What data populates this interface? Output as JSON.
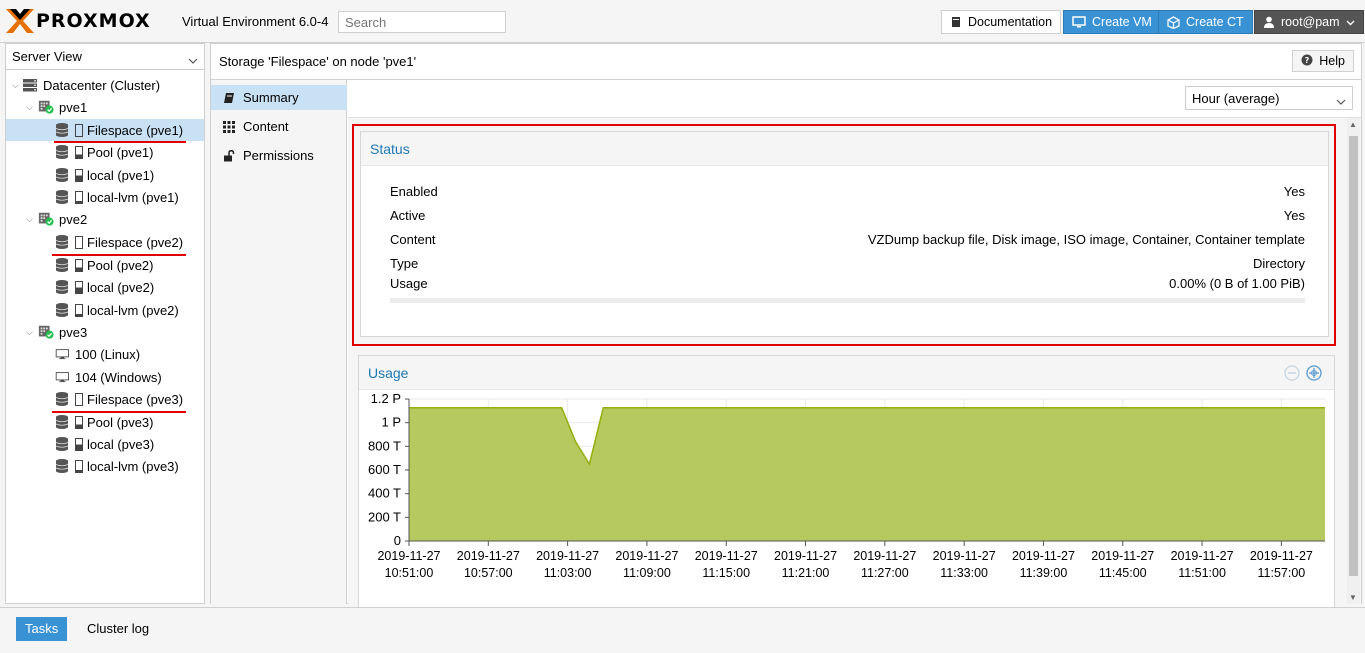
{
  "header": {
    "brand": "PROXMOX",
    "version": "Virtual Environment 6.0-4",
    "search_placeholder": "Search",
    "documentation_label": "Documentation",
    "create_vm_label": "Create VM",
    "create_ct_label": "Create CT",
    "user_label": "root@pam"
  },
  "sidebar": {
    "view": "Server View",
    "datacenter": "Datacenter (Cluster)",
    "nodes": [
      {
        "name": "pve1",
        "items": [
          "Filespace (pve1)",
          "Pool (pve1)",
          "local (pve1)",
          "local-lvm (pve1)"
        ]
      },
      {
        "name": "pve2",
        "items": [
          "Filespace (pve2)",
          "Pool (pve2)",
          "local (pve2)",
          "local-lvm (pve2)"
        ]
      },
      {
        "name": "pve3",
        "items": [
          "100 (Linux)",
          "104 (Windows)",
          "Filespace (pve3)",
          "Pool (pve3)",
          "local (pve3)",
          "local-lvm (pve3)"
        ]
      }
    ],
    "selected": "Filespace (pve1)"
  },
  "main": {
    "title": "Storage 'Filespace' on node 'pve1'",
    "help_label": "Help",
    "nav": [
      "Summary",
      "Content",
      "Permissions"
    ],
    "active_nav": "Summary",
    "timeframe": "Hour (average)"
  },
  "status": {
    "title": "Status",
    "rows": [
      {
        "key": "Enabled",
        "value": "Yes"
      },
      {
        "key": "Active",
        "value": "Yes"
      },
      {
        "key": "Content",
        "value": "VZDump backup file, Disk image, ISO image, Container, Container template"
      },
      {
        "key": "Type",
        "value": "Directory"
      },
      {
        "key": "Usage",
        "value": "0.00% (0 B of 1.00 PiB)"
      }
    ],
    "usage_fraction": 0.0
  },
  "usage_chart": {
    "title": "Usage",
    "chart_data": {
      "type": "area",
      "title": "Usage",
      "ytick_labels": [
        "0",
        "200 T",
        "400 T",
        "600 T",
        "800 T",
        "1 P",
        "1.2 P"
      ],
      "yticks": [
        0,
        200,
        400,
        600,
        800,
        1000,
        1200
      ],
      "ylim": [
        0,
        1200
      ],
      "xtick_dates": [
        "2019-11-27",
        "2019-11-27",
        "2019-11-27",
        "2019-11-27",
        "2019-11-27",
        "2019-11-27",
        "2019-11-27",
        "2019-11-27",
        "2019-11-27",
        "2019-11-27",
        "2019-11-27",
        "2019-11-27"
      ],
      "xtick_times": [
        "10:51:00",
        "10:57:00",
        "11:03:00",
        "11:09:00",
        "11:15:00",
        "11:21:00",
        "11:27:00",
        "11:33:00",
        "11:39:00",
        "11:45:00",
        "11:51:00",
        "11:57:00"
      ],
      "x_minutes": [
        0,
        11,
        12,
        13,
        14,
        60
      ],
      "values": [
        1126,
        1126,
        840,
        650,
        1126,
        1126
      ],
      "fill_color": "#b5c95f",
      "line_color": "#94ae0a",
      "grid": true
    }
  },
  "bottom": {
    "tabs": [
      "Tasks",
      "Cluster log"
    ],
    "active_tab": "Tasks"
  }
}
